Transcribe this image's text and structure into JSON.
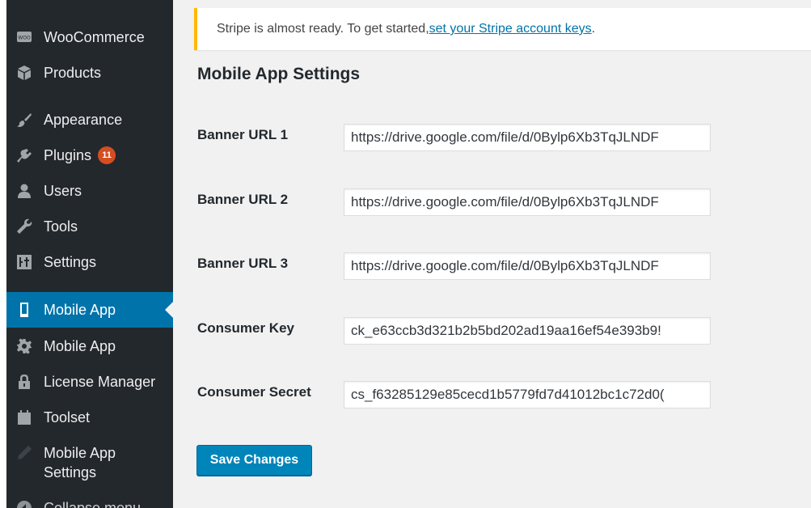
{
  "sidebar": {
    "items": [
      {
        "label": "WooCommerce",
        "icon": "woocommerce-icon"
      },
      {
        "label": "Products",
        "icon": "products-box-icon"
      },
      {
        "label": "Appearance",
        "icon": "paintbrush-icon"
      },
      {
        "label": "Plugins",
        "icon": "plugin-icon",
        "badge": "11"
      },
      {
        "label": "Users",
        "icon": "user-icon"
      },
      {
        "label": "Tools",
        "icon": "wrench-icon"
      },
      {
        "label": "Settings",
        "icon": "settings-sliders-icon"
      },
      {
        "label": "Mobile App",
        "icon": "smartphone-icon",
        "active": true
      },
      {
        "label": "Mobile App",
        "icon": "gear-icon"
      },
      {
        "label": "License Manager",
        "icon": "lock-icon"
      },
      {
        "label": "Toolset",
        "icon": "toolset-icon"
      },
      {
        "label": "Mobile App Settings",
        "icon": "pencil-icon"
      },
      {
        "label": "Collapse menu",
        "icon": "collapse-arrow-icon"
      }
    ],
    "colors": {
      "background": "#23282d",
      "active": "#0073aa",
      "badge": "#d54e21"
    }
  },
  "notice": {
    "text": "Stripe is almost ready. To get started, ",
    "link_text": "set your Stripe account keys",
    "suffix": ".",
    "accent_color": "#ffb900"
  },
  "main": {
    "title": "Mobile App Settings",
    "fields": [
      {
        "label": "Banner URL 1",
        "value": "https://drive.google.com/file/d/0Bylp6Xb3TqJLNDF"
      },
      {
        "label": "Banner URL 2",
        "value": "https://drive.google.com/file/d/0Bylp6Xb3TqJLNDF"
      },
      {
        "label": "Banner URL 3",
        "value": "https://drive.google.com/file/d/0Bylp6Xb3TqJLNDF"
      },
      {
        "label": "Consumer Key",
        "value": "ck_e63ccb3d321b2b5bd202ad19aa16ef54e393b9!"
      },
      {
        "label": "Consumer Secret",
        "value": "cs_f63285129e85cecd1b5779fd7d41012bc1c72d0("
      }
    ],
    "save_label": "Save Changes",
    "button_color": "#0085ba"
  }
}
